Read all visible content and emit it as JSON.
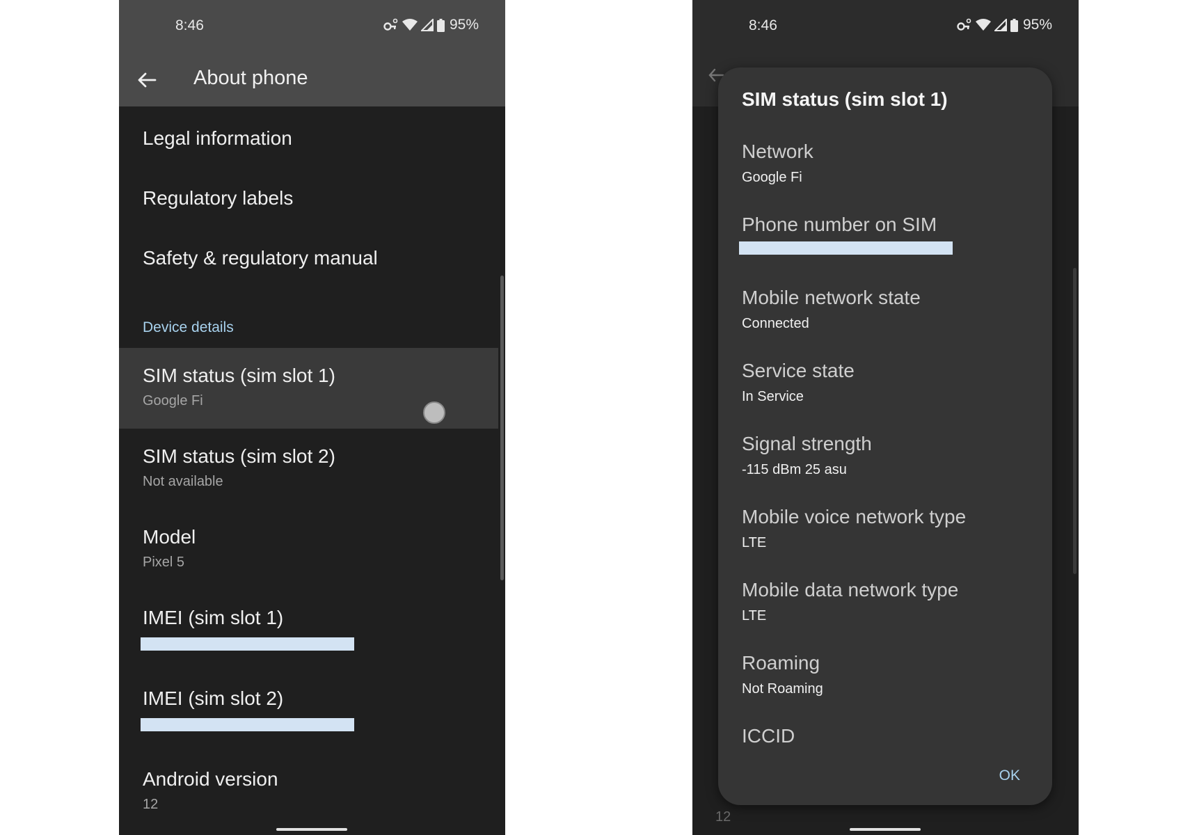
{
  "left_screen": {
    "status_bar": {
      "time": "8:46",
      "battery": "95%"
    },
    "app_bar": {
      "title": "About phone"
    },
    "items_top": [
      {
        "title": "Legal information"
      },
      {
        "title": "Regulatory labels"
      },
      {
        "title": "Safety & regulatory manual"
      }
    ],
    "section_header": "Device details",
    "items": [
      {
        "title": "SIM status (sim slot 1)",
        "subtitle": "Google Fi"
      },
      {
        "title": "SIM status (sim slot 2)",
        "subtitle": "Not available"
      },
      {
        "title": "Model",
        "subtitle": "Pixel 5"
      },
      {
        "title": "IMEI (sim slot 1)",
        "subtitle": ""
      },
      {
        "title": "IMEI (sim slot 2)",
        "subtitle": ""
      },
      {
        "title": "Android version",
        "subtitle": "12"
      }
    ]
  },
  "right_screen": {
    "status_bar": {
      "time": "8:46",
      "battery": "95%"
    },
    "background_visible_text": "12",
    "dialog": {
      "title": "SIM status (sim slot 1)",
      "items": [
        {
          "label": "Network",
          "value": "Google Fi"
        },
        {
          "label": "Phone number on SIM",
          "value": ""
        },
        {
          "label": "Mobile network state",
          "value": "Connected"
        },
        {
          "label": "Service state",
          "value": "In Service"
        },
        {
          "label": "Signal strength",
          "value": "-115 dBm 25 asu"
        },
        {
          "label": "Mobile voice network type",
          "value": "LTE"
        },
        {
          "label": "Mobile data network type",
          "value": "LTE"
        },
        {
          "label": "Roaming",
          "value": "Not Roaming"
        },
        {
          "label": "ICCID",
          "value": ""
        }
      ],
      "ok_label": "OK"
    }
  },
  "colors": {
    "accent": "#a8d2ee",
    "background": "#1f1f1f",
    "app_bar": "#4a4a4a",
    "dialog": "#353535",
    "redaction": "#d3e3f3"
  },
  "icons": [
    "back-arrow-icon",
    "vpn-key-icon",
    "wifi-icon",
    "cell-signal-icon",
    "battery-icon"
  ]
}
